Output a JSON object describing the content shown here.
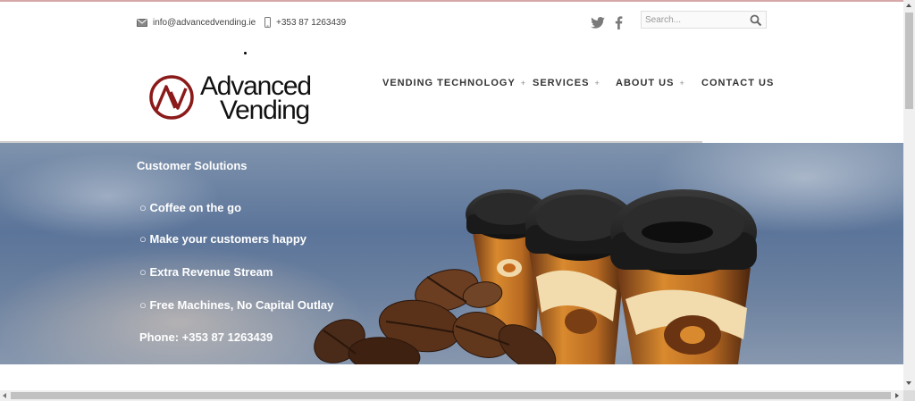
{
  "header": {
    "email": "info@advancedvending.ie",
    "phone": "+353 87 1263439",
    "search": {
      "placeholder": "Search..."
    },
    "social": [
      "twitter-icon",
      "facebook-icon"
    ]
  },
  "logo": {
    "line1": "Advanced",
    "line2": "Vending",
    "brand_color": "#8b1a1a"
  },
  "nav": {
    "items": [
      {
        "label": "VENDING TECHNOLOGY",
        "has_submenu": "+"
      },
      {
        "label": "SERVICES",
        "has_submenu": "+"
      },
      {
        "label": "ABOUT US",
        "has_submenu": "+"
      },
      {
        "label": "CONTACT US"
      }
    ]
  },
  "hero": {
    "title": "Customer Solutions",
    "items": [
      "○ Coffee on the go",
      "○ Make your customers happy",
      "○ Extra Revenue Stream",
      "○ Free Machines, No Capital Outlay"
    ],
    "phone_line": "Phone: +353 87 1263439"
  }
}
